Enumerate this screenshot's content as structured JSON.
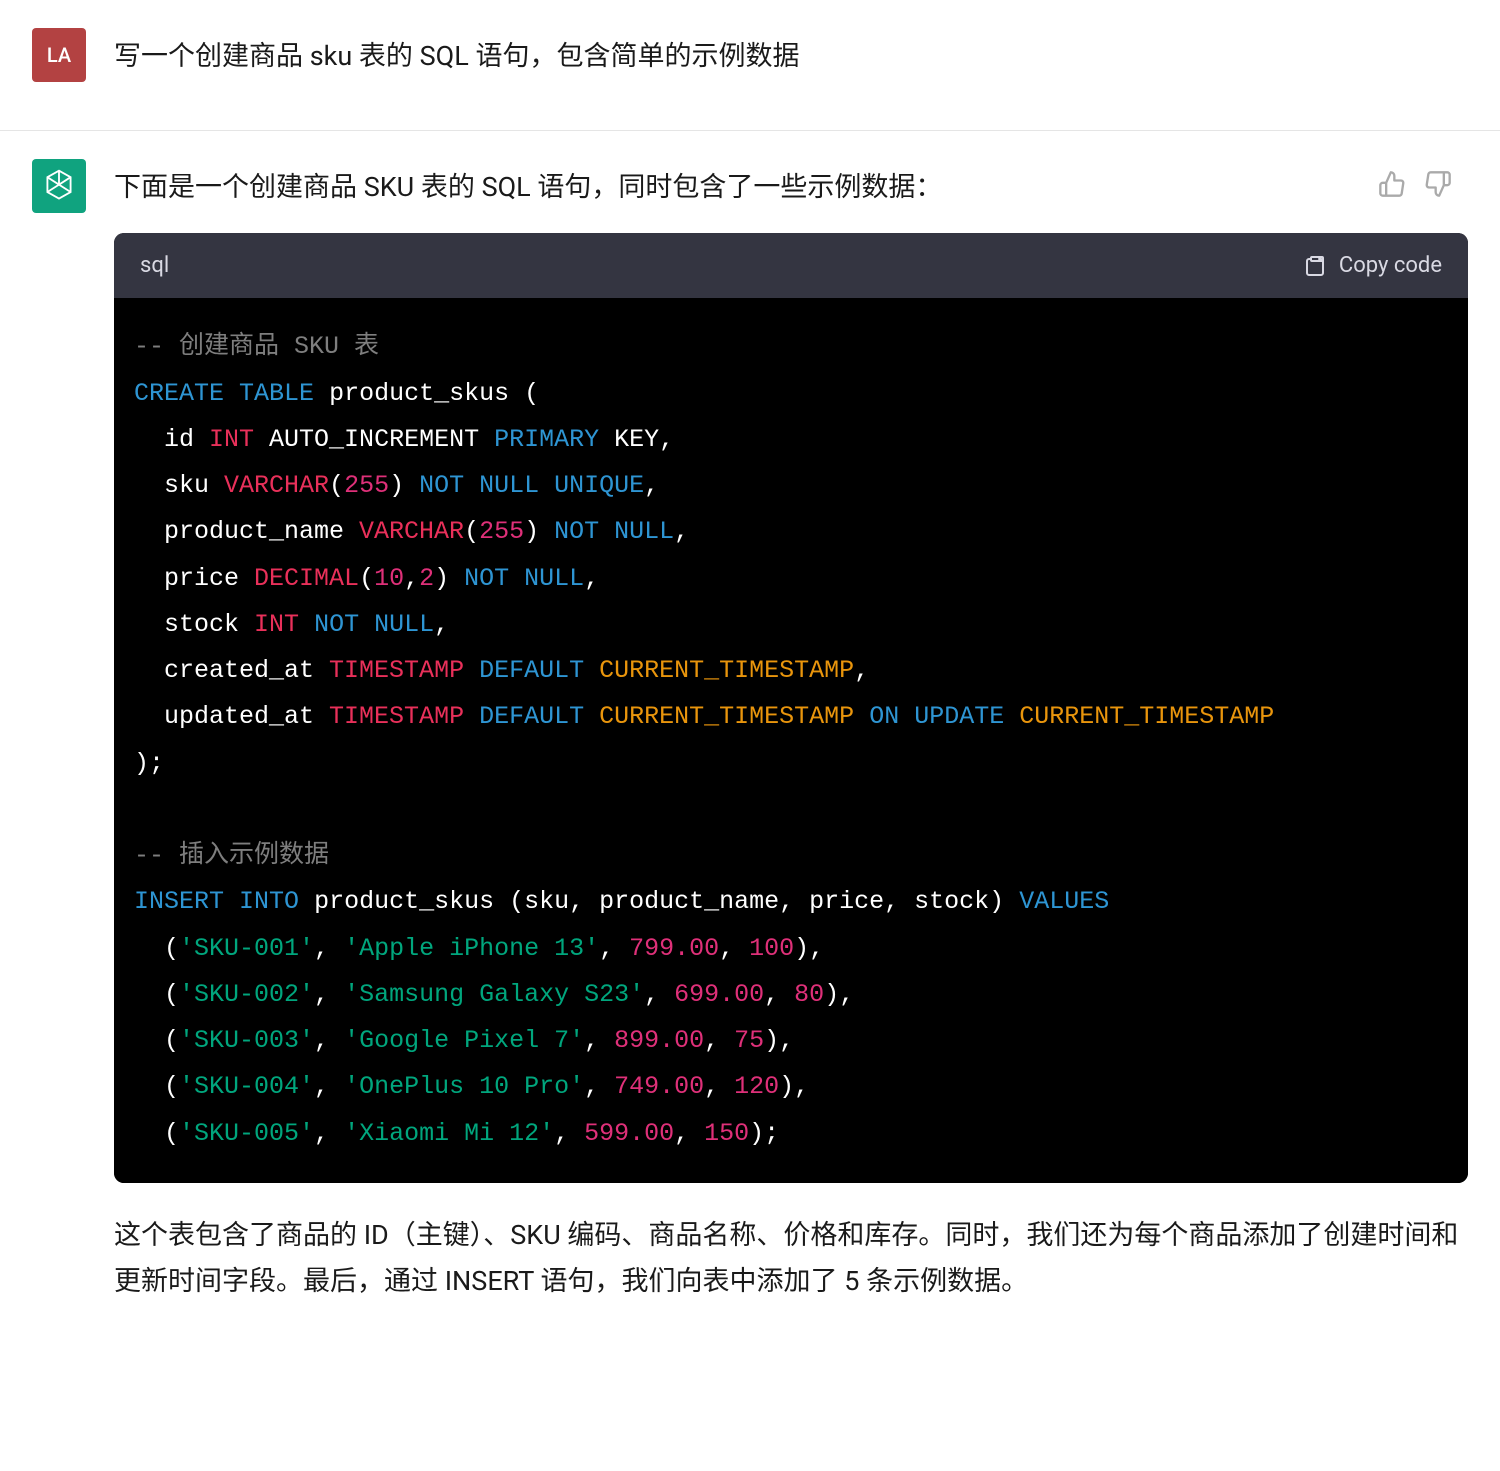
{
  "user": {
    "avatar": "LA",
    "prompt": "写一个创建商品 sku 表的 SQL 语句，包含简单的示例数据"
  },
  "assistant": {
    "intro": "下面是一个创建商品 SKU 表的 SQL 语句，同时包含了一些示例数据：",
    "code": {
      "language": "sql",
      "copy_label": "Copy code",
      "tokens": [
        [
          [
            "cm",
            "-- 创建商品 SKU 表"
          ]
        ],
        [
          [
            "kw",
            "CREATE"
          ],
          [
            "pn",
            " "
          ],
          [
            "kw",
            "TABLE"
          ],
          [
            "pn",
            " "
          ],
          [
            "id",
            "product_skus ("
          ]
        ],
        [
          [
            "pn",
            "  id "
          ],
          [
            "ty",
            "INT"
          ],
          [
            "pn",
            " "
          ],
          [
            "id",
            "AUTO_INCREMENT "
          ],
          [
            "kw",
            "PRIMARY"
          ],
          [
            "pn",
            " "
          ],
          [
            "id",
            "KEY,"
          ]
        ],
        [
          [
            "pn",
            "  sku "
          ],
          [
            "fn",
            "VARCHAR"
          ],
          [
            "pn",
            "("
          ],
          [
            "nm",
            "255"
          ],
          [
            "pn",
            ") "
          ],
          [
            "kw",
            "NOT"
          ],
          [
            "pn",
            " "
          ],
          [
            "kw",
            "NULL"
          ],
          [
            "pn",
            " "
          ],
          [
            "kw",
            "UNIQUE"
          ],
          [
            "pn",
            ","
          ]
        ],
        [
          [
            "pn",
            "  product_name "
          ],
          [
            "fn",
            "VARCHAR"
          ],
          [
            "pn",
            "("
          ],
          [
            "nm",
            "255"
          ],
          [
            "pn",
            ") "
          ],
          [
            "kw",
            "NOT"
          ],
          [
            "pn",
            " "
          ],
          [
            "kw",
            "NULL"
          ],
          [
            "pn",
            ","
          ]
        ],
        [
          [
            "pn",
            "  price "
          ],
          [
            "fn",
            "DECIMAL"
          ],
          [
            "pn",
            "("
          ],
          [
            "nm",
            "10"
          ],
          [
            "pn",
            ","
          ],
          [
            "nm",
            "2"
          ],
          [
            "pn",
            ") "
          ],
          [
            "kw",
            "NOT"
          ],
          [
            "pn",
            " "
          ],
          [
            "kw",
            "NULL"
          ],
          [
            "pn",
            ","
          ]
        ],
        [
          [
            "pn",
            "  stock "
          ],
          [
            "ty",
            "INT"
          ],
          [
            "pn",
            " "
          ],
          [
            "kw",
            "NOT"
          ],
          [
            "pn",
            " "
          ],
          [
            "kw",
            "NULL"
          ],
          [
            "pn",
            ","
          ]
        ],
        [
          [
            "pn",
            "  created_at "
          ],
          [
            "ty",
            "TIMESTAMP"
          ],
          [
            "pn",
            " "
          ],
          [
            "de",
            "DEFAULT"
          ],
          [
            "pn",
            " "
          ],
          [
            "cn",
            "CURRENT_TIMESTAMP"
          ],
          [
            "pn",
            ","
          ]
        ],
        [
          [
            "pn",
            "  updated_at "
          ],
          [
            "ty",
            "TIMESTAMP"
          ],
          [
            "pn",
            " "
          ],
          [
            "de",
            "DEFAULT"
          ],
          [
            "pn",
            " "
          ],
          [
            "cn",
            "CURRENT_TIMESTAMP"
          ],
          [
            "pn",
            " "
          ],
          [
            "kw",
            "ON"
          ],
          [
            "pn",
            " "
          ],
          [
            "kw",
            "UPDATE"
          ],
          [
            "pn",
            " "
          ],
          [
            "cn",
            "CURRENT_TIMESTAMP"
          ]
        ],
        [
          [
            "pn",
            ");"
          ]
        ],
        [],
        [
          [
            "cm",
            "-- 插入示例数据"
          ]
        ],
        [
          [
            "kw",
            "INSERT"
          ],
          [
            "pn",
            " "
          ],
          [
            "kw",
            "INTO"
          ],
          [
            "pn",
            " "
          ],
          [
            "id",
            "product_skus (sku, product_name, price, stock) "
          ],
          [
            "kw",
            "VALUES"
          ]
        ],
        [
          [
            "pn",
            "  ("
          ],
          [
            "st",
            "'SKU-001'"
          ],
          [
            "pn",
            ", "
          ],
          [
            "st",
            "'Apple iPhone 13'"
          ],
          [
            "pn",
            ", "
          ],
          [
            "nm",
            "799.00"
          ],
          [
            "pn",
            ", "
          ],
          [
            "nm",
            "100"
          ],
          [
            "pn",
            "),"
          ]
        ],
        [
          [
            "pn",
            "  ("
          ],
          [
            "st",
            "'SKU-002'"
          ],
          [
            "pn",
            ", "
          ],
          [
            "st",
            "'Samsung Galaxy S23'"
          ],
          [
            "pn",
            ", "
          ],
          [
            "nm",
            "699.00"
          ],
          [
            "pn",
            ", "
          ],
          [
            "nm",
            "80"
          ],
          [
            "pn",
            "),"
          ]
        ],
        [
          [
            "pn",
            "  ("
          ],
          [
            "st",
            "'SKU-003'"
          ],
          [
            "pn",
            ", "
          ],
          [
            "st",
            "'Google Pixel 7'"
          ],
          [
            "pn",
            ", "
          ],
          [
            "nm",
            "899.00"
          ],
          [
            "pn",
            ", "
          ],
          [
            "nm",
            "75"
          ],
          [
            "pn",
            "),"
          ]
        ],
        [
          [
            "pn",
            "  ("
          ],
          [
            "st",
            "'SKU-004'"
          ],
          [
            "pn",
            ", "
          ],
          [
            "st",
            "'OnePlus 10 Pro'"
          ],
          [
            "pn",
            ", "
          ],
          [
            "nm",
            "749.00"
          ],
          [
            "pn",
            ", "
          ],
          [
            "nm",
            "120"
          ],
          [
            "pn",
            "),"
          ]
        ],
        [
          [
            "pn",
            "  ("
          ],
          [
            "st",
            "'SKU-005'"
          ],
          [
            "pn",
            ", "
          ],
          [
            "st",
            "'Xiaomi Mi 12'"
          ],
          [
            "pn",
            ", "
          ],
          [
            "nm",
            "599.00"
          ],
          [
            "pn",
            ", "
          ],
          [
            "nm",
            "150"
          ],
          [
            "pn",
            ");"
          ]
        ]
      ]
    },
    "outro": "这个表包含了商品的 ID（主键）、SKU 编码、商品名称、价格和库存。同时，我们还为每个商品添加了创建时间和更新时间字段。最后，通过 INSERT 语句，我们向表中添加了 5 条示例数据。"
  }
}
